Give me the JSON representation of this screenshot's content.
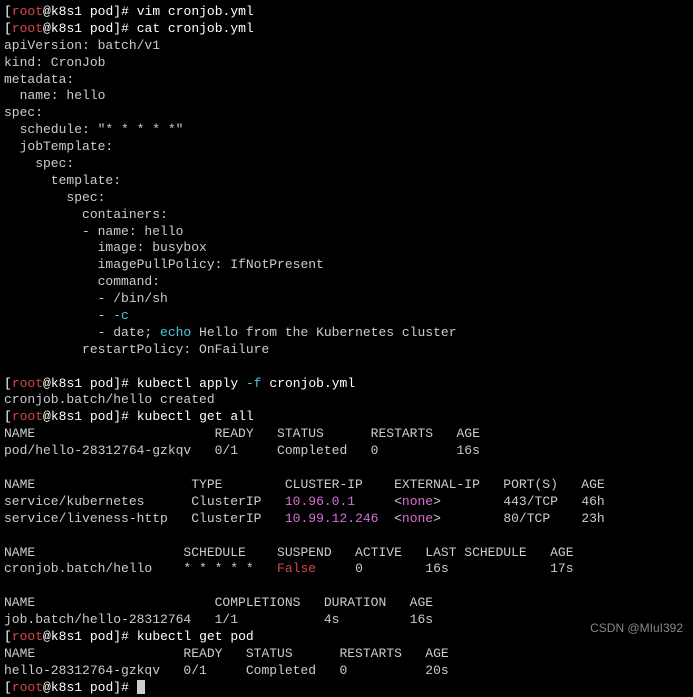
{
  "prompt": {
    "user": "root",
    "host": "k8s1",
    "path": "pod",
    "symbol": "#"
  },
  "commands": {
    "vim": "vim cronjob.yml",
    "cat": "cat cronjob.yml",
    "apply": "kubectl apply ",
    "apply_flag": "-f",
    "apply_file": " cronjob.yml",
    "getall": "kubectl get all",
    "getpod": "kubectl get pod"
  },
  "yaml": {
    "l1": "apiVersion: batch/v1",
    "l2": "kind: CronJob",
    "l3": "metadata:",
    "l4": "  name: hello",
    "l5": "spec:",
    "l6": "  schedule: \"* * * * *\"",
    "l7": "  jobTemplate:",
    "l8": "    spec:",
    "l9": "      template:",
    "l10": "        spec:",
    "l11": "          containers:",
    "l12": "          - name: hello",
    "l13": "            image: busybox",
    "l14": "            imagePullPolicy: IfNotPresent",
    "l15": "            command:",
    "l16": "            - /bin/sh",
    "l17a": "            - ",
    "l17b": "-c",
    "l18a": "            - date; ",
    "l18b": "echo",
    "l18c": " Hello from the Kubernetes cluster",
    "l19": "          restartPolicy: OnFailure"
  },
  "apply_result": "cronjob.batch/hello created",
  "pods_header": "NAME                       READY   STATUS      RESTARTS   AGE",
  "pods_row1": "pod/hello-28312764-gzkqv   0/1     Completed   0          16s",
  "svc_header": "NAME                    TYPE        CLUSTER-IP    EXTERNAL-IP   PORT(S)   AGE",
  "svc_row1_a": "service/kubernetes      ClusterIP   ",
  "svc_row1_ip": "10.96.0.1",
  "svc_row1_b": "     <",
  "svc_row1_none": "none",
  "svc_row1_c": ">        443/TCP   46h",
  "svc_row2_a": "service/liveness-http   ClusterIP   ",
  "svc_row2_ip": "10.99.12.246",
  "svc_row2_b": "  <",
  "svc_row2_none": "none",
  "svc_row2_c": ">        80/TCP    23h",
  "cron_header": "NAME                   SCHEDULE    SUSPEND   ACTIVE   LAST SCHEDULE   AGE",
  "cron_row_a": "cronjob.batch/hello    * * * * *   ",
  "cron_row_false": "False",
  "cron_row_b": "     0        16s             17s",
  "job_header": "NAME                       COMPLETIONS   DURATION   AGE",
  "job_row": "job.batch/hello-28312764   1/1           4s         16s",
  "pod2_header": "NAME                   READY   STATUS      RESTARTS   AGE",
  "pod2_row": "hello-28312764-gzkqv   0/1     Completed   0          20s",
  "watermark": "CSDN @MIuI392"
}
